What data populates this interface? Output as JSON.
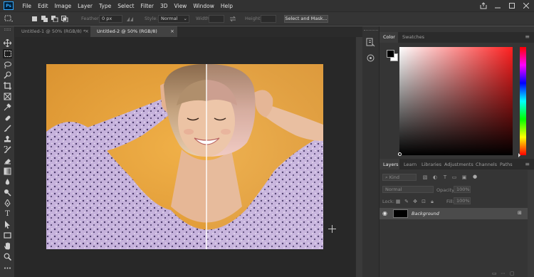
{
  "app": {
    "logo_text": "Ps",
    "menu": [
      "File",
      "Edit",
      "Image",
      "Layer",
      "Type",
      "Select",
      "Filter",
      "3D",
      "View",
      "Window",
      "Help"
    ]
  },
  "options": {
    "feather_label": "Feather:",
    "feather_value": "0 px",
    "style_label": "Style:",
    "style_value": "Normal",
    "width_label": "Width:",
    "height_label": "Height:",
    "select_mask_label": "Select and Mask..."
  },
  "tabs": [
    {
      "label": "Untitled-1 @ 50% (RGB/8) *",
      "close": "×"
    },
    {
      "label": "Untitled-2 @ 50% (RGB/8)",
      "close": "×"
    }
  ],
  "color_panel": {
    "tabs": [
      "Color",
      "Swatches"
    ],
    "hue_colors": "#ff3333",
    "foreground": "#000000",
    "background": "#ffffff"
  },
  "layers_panel": {
    "tabs": [
      "Layers",
      "Learn",
      "Libraries",
      "Adjustments",
      "Channels",
      "Paths"
    ],
    "kind_label": "Kind",
    "blend_mode": "Normal",
    "opacity_label": "Opacity:",
    "opacity_value": "100%",
    "lock_label": "Lock:",
    "fill_label": "Fill:",
    "fill_value": "100%",
    "layer_name": "Background"
  },
  "canvas": {
    "background_color": "#e8a437"
  }
}
